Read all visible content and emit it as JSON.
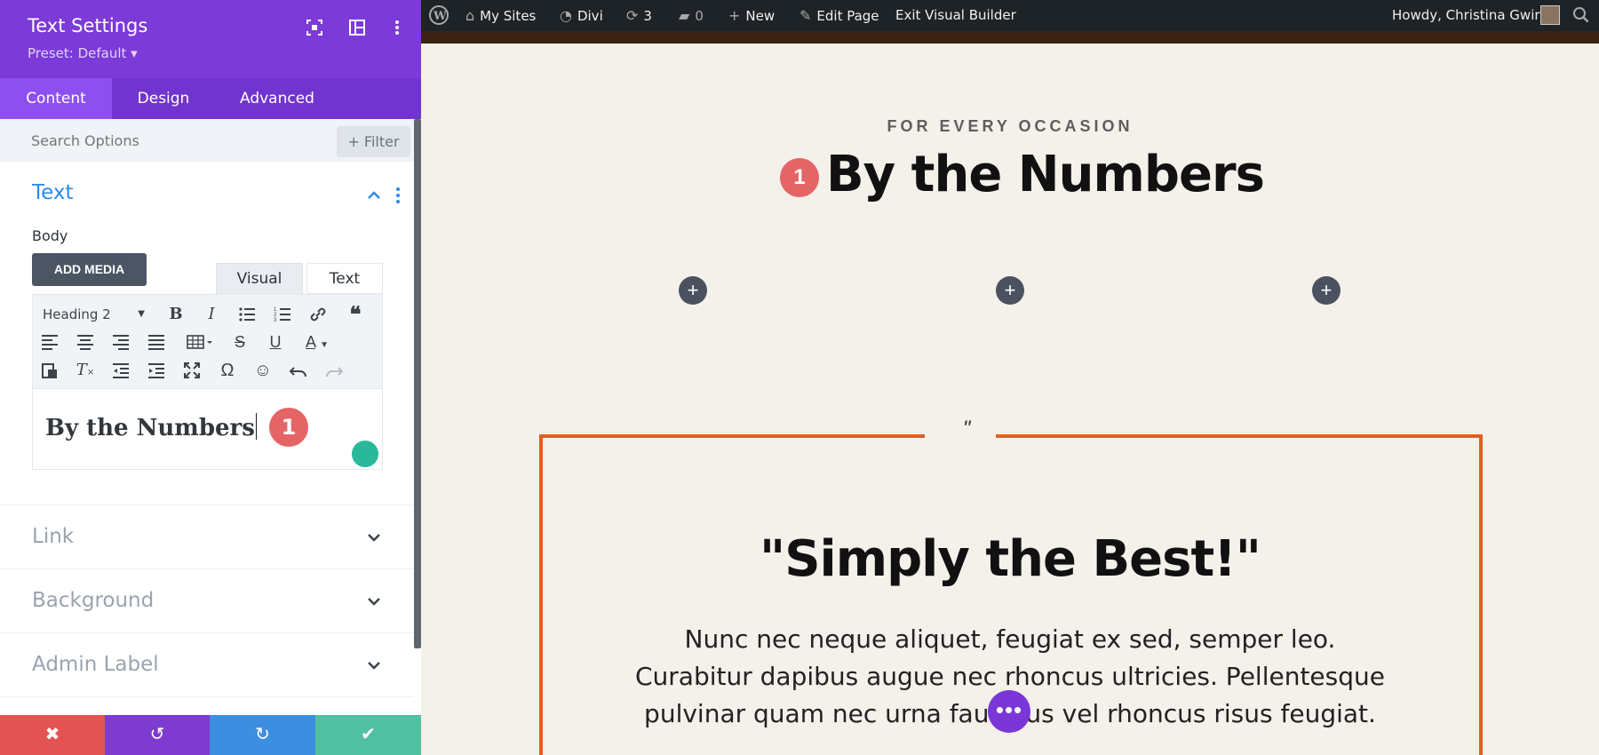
{
  "panel": {
    "title": "Text Settings",
    "preset": "Preset: Default ▾",
    "tabs": [
      {
        "label": "Content",
        "active": true
      },
      {
        "label": "Design",
        "active": false
      },
      {
        "label": "Advanced",
        "active": false
      }
    ],
    "search_placeholder": "Search Options",
    "filter_label": "+ Filter",
    "text_section": {
      "title": "Text",
      "body_label": "Body",
      "add_media": "ADD MEDIA",
      "editor_tabs": {
        "visual": "Visual",
        "text": "Text"
      },
      "format": "Heading 2",
      "content": "By the Numbers",
      "badge": "1"
    },
    "sections": [
      {
        "title": "Link"
      },
      {
        "title": "Background"
      },
      {
        "title": "Admin Label"
      }
    ],
    "footer": {
      "cancel": "✖",
      "undo": "↺",
      "redo": "↻",
      "save": "✔"
    },
    "colors": {
      "header": "#7c3ad8",
      "accent": "#2e8ae6",
      "cancel": "#e45353",
      "undo": "#7e3bd0",
      "redo": "#3c8fe0",
      "save": "#51c1a1"
    }
  },
  "admin_bar": {
    "my_sites": "My Sites",
    "site": "Divi",
    "updates": "3",
    "comments": "0",
    "new": "New",
    "edit_page": "Edit Page",
    "exit": "Exit Visual Builder",
    "howdy": "Howdy, Christina Gwira"
  },
  "page": {
    "overline": "FOR EVERY OCCASION",
    "heading": "By the Numbers",
    "heading_badge": "1",
    "quote_mark": "\"",
    "quote_heading": "\"Simply the Best!\"",
    "quote_body": "Nunc nec neque aliquet, feugiat ex sed, semper leo. Curabitur dapibus augue nec rhoncus ultricies. Pellentesque pulvinar quam nec urna faucibus vel rhoncus risus feugiat.",
    "fab": "•••"
  }
}
